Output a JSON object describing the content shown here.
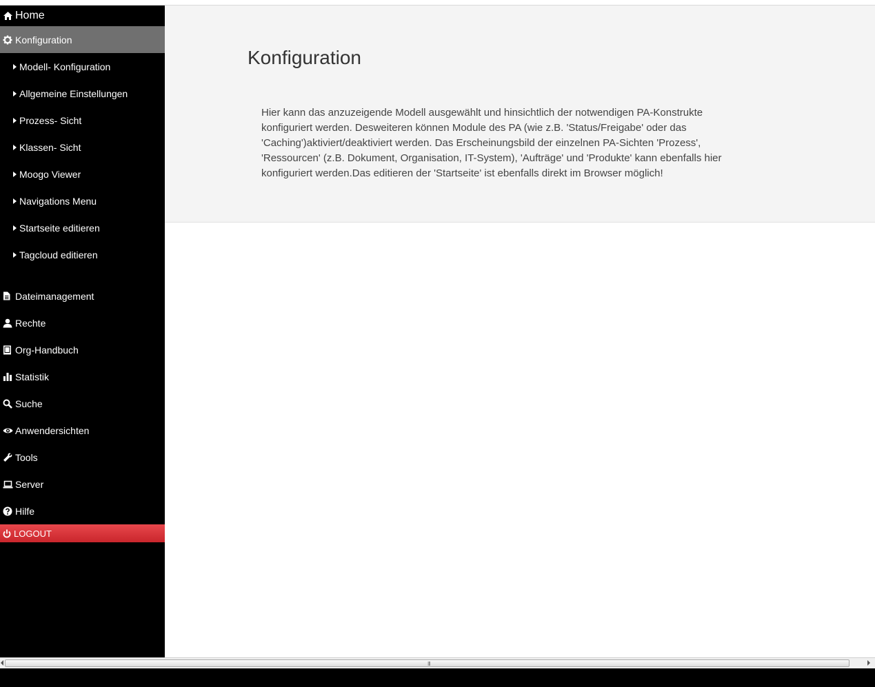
{
  "sidebar": {
    "home": {
      "label": "Home",
      "icon": "home-icon"
    },
    "active": {
      "label": "Konfiguration",
      "icon": "gear-icon"
    },
    "sub_items": [
      {
        "label": "Modell- Konfiguration"
      },
      {
        "label": "Allgemeine Einstellungen"
      },
      {
        "label": "Prozess- Sicht"
      },
      {
        "label": "Klassen- Sicht"
      },
      {
        "label": "Moogo Viewer"
      },
      {
        "label": "Navigations Menu"
      },
      {
        "label": "Startseite editieren"
      },
      {
        "label": "Tagcloud editieren"
      }
    ],
    "items": [
      {
        "label": "Dateimanagement",
        "icon": "file-icon"
      },
      {
        "label": "Rechte",
        "icon": "user-icon"
      },
      {
        "label": "Org-Handbuch",
        "icon": "book-icon"
      },
      {
        "label": "Statistik",
        "icon": "bar-chart-icon"
      },
      {
        "label": "Suche",
        "icon": "search-icon"
      },
      {
        "label": "Anwendersichten",
        "icon": "eye-icon"
      },
      {
        "label": "Tools",
        "icon": "wrench-icon"
      },
      {
        "label": "Server",
        "icon": "laptop-icon"
      },
      {
        "label": "Hilfe",
        "icon": "question-icon"
      }
    ],
    "logout": {
      "label": "LOGOUT",
      "icon": "power-icon"
    },
    "colors": {
      "active_bg": "#707070",
      "logout_bg": "#d9343a"
    }
  },
  "main": {
    "title": "Konfiguration",
    "description": "Hier kann das anzuzeigende Modell ausgewählt und hinsichtlich der notwendigen PA-Konstrukte konfiguriert werden. Desweiteren können Module des PA (wie z.B. 'Status/Freigabe' oder das 'Caching')aktiviert/deaktiviert werden. Das Erscheinungsbild der einzelnen PA-Sichten 'Prozess', 'Ressourcen' (z.B. Dokument, Organisation, IT-System), 'Aufträge' und 'Produkte' kann ebenfalls hier konfiguriert werden.Das editieren der 'Startseite' ist ebenfalls direkt im Browser möglich!"
  },
  "scrollbar": {
    "grip": "III"
  }
}
